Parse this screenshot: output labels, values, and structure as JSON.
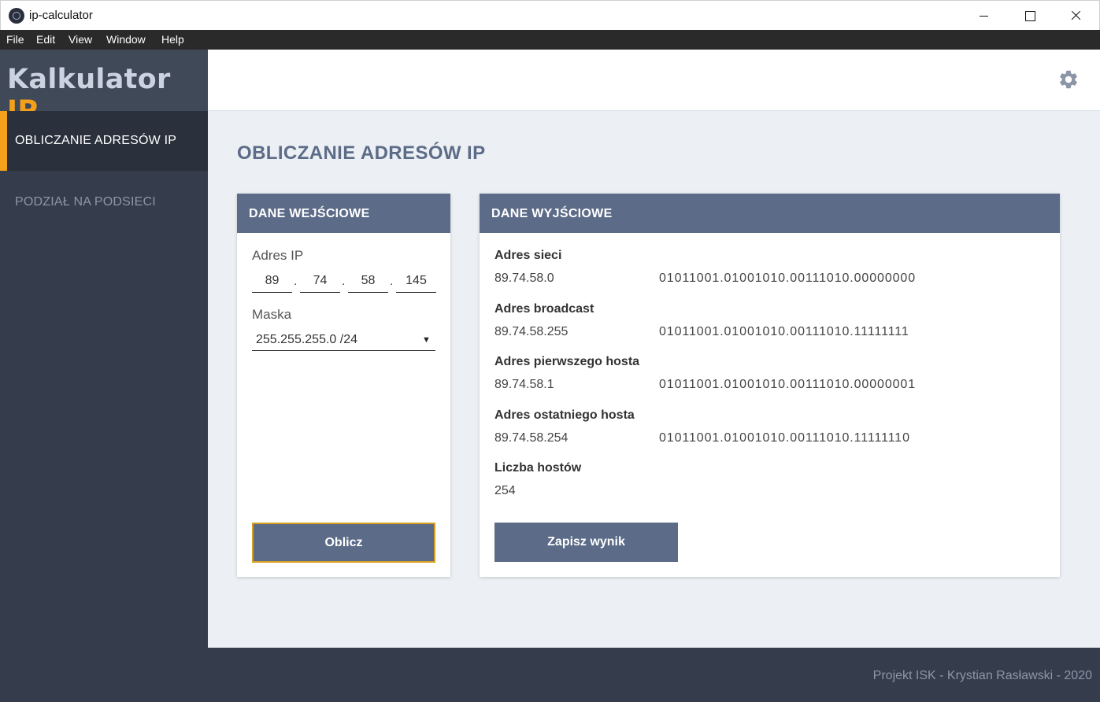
{
  "window": {
    "title": "ip-calculator"
  },
  "menu": [
    "File",
    "Edit",
    "View",
    "Window",
    "Help"
  ],
  "sidebar": {
    "logo_main": "Kalkulator",
    "logo_accent": "IP",
    "items": [
      {
        "label": "OBLICZANIE ADRESÓW IP",
        "active": true
      },
      {
        "label": "PODZIAŁ NA PODSIECI",
        "active": false
      }
    ]
  },
  "header": {
    "settings_icon": "gear-icon"
  },
  "main": {
    "title": "OBLICZANIE ADRESÓW IP",
    "input": {
      "heading": "DANE WEJŚCIOWE",
      "ip_label": "Adres IP",
      "octets": [
        "89",
        "74",
        "58",
        "145"
      ],
      "dot": ".",
      "mask_label": "Maska",
      "mask_value": "255.255.255.0 /24",
      "submit": "Oblicz"
    },
    "output": {
      "heading": "DANE WYJŚCIOWE",
      "rows": [
        {
          "label": "Adres sieci",
          "decimal": "89.74.58.0",
          "binary": "01011001.01001010.00111010.00000000"
        },
        {
          "label": "Adres broadcast",
          "decimal": "89.74.58.255",
          "binary": "01011001.01001010.00111010.11111111"
        },
        {
          "label": "Adres pierwszego hosta",
          "decimal": "89.74.58.1",
          "binary": "01011001.01001010.00111010.00000001"
        },
        {
          "label": "Adres ostatniego hosta",
          "decimal": "89.74.58.254",
          "binary": "01011001.01001010.00111010.11111110"
        },
        {
          "label": "Liczba hostów",
          "decimal": "254",
          "binary": ""
        }
      ],
      "save": "Zapisz wynik"
    }
  },
  "footer": {
    "credit": "Projekt ISK - Krystian Rasławski - 2020"
  },
  "colors": {
    "accent": "#f5a01a",
    "primary": "#5c6b87",
    "sidebar": "#353d4c"
  }
}
